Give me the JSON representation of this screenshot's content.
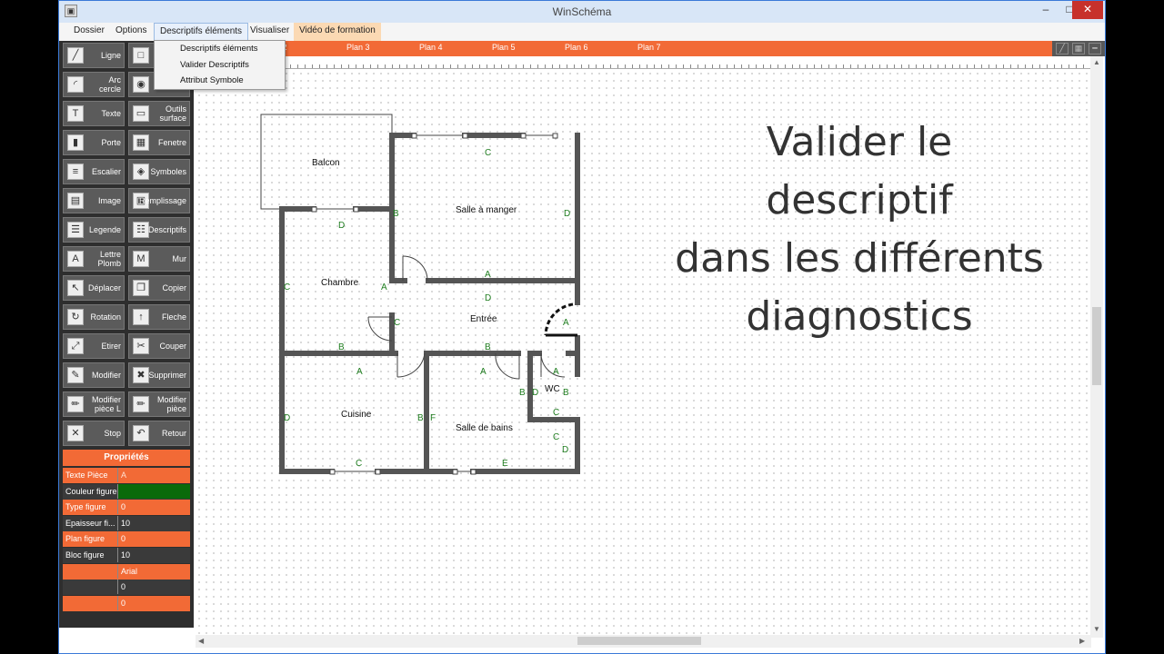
{
  "window": {
    "title": "WinSchéma",
    "min": "–",
    "max": "□",
    "close": "✕"
  },
  "menu": {
    "dossier": "Dossier",
    "options": "Options",
    "descriptifs": "Descriptifs éléments",
    "visualiser": "Visualiser",
    "video": "Vidéo de formation"
  },
  "dropdown": [
    "Descriptifs éléments",
    "Valider Descriptifs",
    "Attribut Symbole"
  ],
  "plans": [
    "n 2",
    "Plan 3",
    "Plan 4",
    "Plan 5",
    "Plan 6",
    "Plan 7"
  ],
  "tools": [
    {
      "label": "Ligne",
      "icon": "line-icon"
    },
    {
      "label": "",
      "icon": "rectangle-icon"
    },
    {
      "label": "Arc cercle",
      "icon": "arc-icon"
    },
    {
      "label": "",
      "icon": "circle-icon"
    },
    {
      "label": "Texte",
      "icon": "text-icon"
    },
    {
      "label": "Outils surface",
      "icon": "surface-icon"
    },
    {
      "label": "Porte",
      "icon": "door-icon"
    },
    {
      "label": "Fenetre",
      "icon": "window-icon"
    },
    {
      "label": "Escalier",
      "icon": "stairs-icon"
    },
    {
      "label": "Symboles",
      "icon": "symbol-icon"
    },
    {
      "label": "Image",
      "icon": "image-icon"
    },
    {
      "label": "Remplissage",
      "icon": "fill-icon"
    },
    {
      "label": "Legende",
      "icon": "legend-icon"
    },
    {
      "label": "Descriptifs",
      "icon": "list-icon"
    },
    {
      "label": "Lettre Plomb",
      "icon": "lead-letter-icon"
    },
    {
      "label": "Mur",
      "icon": "wall-icon"
    },
    {
      "label": "Déplacer",
      "icon": "cursor-icon"
    },
    {
      "label": "Copier",
      "icon": "copy-icon"
    },
    {
      "label": "Rotation",
      "icon": "rotate-icon"
    },
    {
      "label": "Fleche",
      "icon": "arrow-icon"
    },
    {
      "label": "Etirer",
      "icon": "stretch-icon"
    },
    {
      "label": "Couper",
      "icon": "cut-icon"
    },
    {
      "label": "Modifier",
      "icon": "edit-icon"
    },
    {
      "label": "Supprimer",
      "icon": "delete-icon"
    },
    {
      "label": "Modifier pièce L",
      "icon": "pencil-icon"
    },
    {
      "label": "Modifier pièce",
      "icon": "pencil-icon"
    },
    {
      "label": "Stop",
      "icon": "stop-icon"
    },
    {
      "label": "Retour",
      "icon": "undo-icon"
    }
  ],
  "props": {
    "header": "Propriétés",
    "rows": [
      {
        "k": "Texte Pièce",
        "v": "A",
        "style": "orange"
      },
      {
        "k": "Couleur figure",
        "v": "",
        "style": "dark",
        "swatch": "#0a6a0a"
      },
      {
        "k": "Type figure",
        "v": "0",
        "style": "orange"
      },
      {
        "k": "Epaisseur fi...",
        "v": "10",
        "style": "dark"
      },
      {
        "k": "Plan figure",
        "v": "0",
        "style": "orange"
      },
      {
        "k": "Bloc figure",
        "v": "10",
        "style": "dark"
      },
      {
        "k": "",
        "v": "Arial",
        "style": "orange"
      },
      {
        "k": "",
        "v": "0",
        "style": "dark"
      },
      {
        "k": "",
        "v": "0",
        "style": "orange"
      }
    ]
  },
  "rooms": {
    "balcon": "Balcon",
    "salle": "Salle à manger",
    "chambre": "Chambre",
    "entree": "Entrée",
    "cuisine": "Cuisine",
    "bains": "Salle de bains",
    "wc": "WC"
  },
  "caption": [
    "Valider le descriptif",
    "dans les différents",
    "diagnostics"
  ],
  "colors": {
    "accent": "#f26a36",
    "wall": "#555555",
    "letters": "#1f7d1f"
  }
}
